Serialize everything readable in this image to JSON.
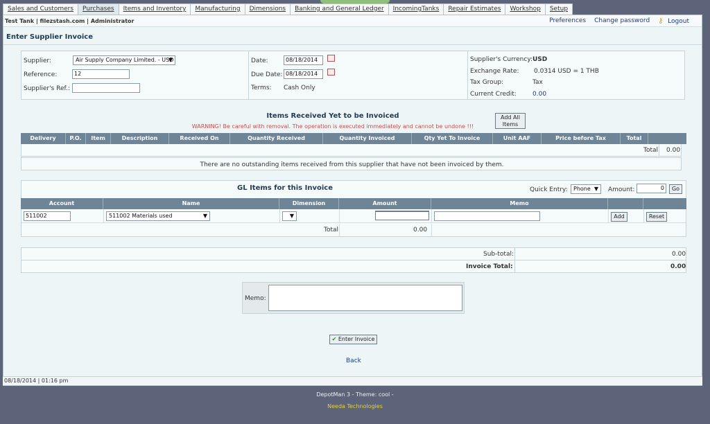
{
  "tabs": [
    {
      "label": "Sales and Customers",
      "active": false
    },
    {
      "label": "Purchases",
      "active": true
    },
    {
      "label": "Items and Inventory",
      "active": false
    },
    {
      "label": "Manufacturing",
      "active": false
    },
    {
      "label": "Dimensions",
      "active": false
    },
    {
      "label": "Banking and General Ledger",
      "active": false
    },
    {
      "label": "IncomingTanks",
      "active": false
    },
    {
      "label": "Repair Estimates",
      "active": false
    },
    {
      "label": "Workshop",
      "active": false
    },
    {
      "label": "Setup",
      "active": false
    }
  ],
  "header": {
    "company": "Test Tank | filezstash.com | Administrator",
    "preferences": "Preferences",
    "change_password": "Change password",
    "logout": "Logout"
  },
  "page_title": "Enter Supplier Invoice",
  "form": {
    "supplier_label": "Supplier:",
    "supplier_value": "Air Supply Company Limited. - USD",
    "reference_label": "Reference:",
    "reference_value": "12",
    "suppliers_ref_label": "Supplier's Ref.:",
    "suppliers_ref_value": "",
    "date_label": "Date:",
    "date_value": "08/18/2014",
    "due_date_label": "Due Date:",
    "due_date_value": "08/18/2014",
    "terms_label": "Terms:",
    "terms_value": "Cash Only",
    "currency_label": "Supplier's Currency:",
    "currency_value": "USD",
    "exchange_label": "Exchange Rate:",
    "exchange_value": "0.0314  USD = 1 THB",
    "taxgroup_label": "Tax Group:",
    "taxgroup_value": "Tax",
    "credit_label": "Current Credit:",
    "credit_value": "0.00"
  },
  "received": {
    "title": "Items Received Yet to be Invoiced",
    "warning": "WARNING! Be careful with removal. The operation is executed immediately and cannot be undone !!!",
    "add_all_label_1": "Add All",
    "add_all_label_2": "Items",
    "columns": [
      "Delivery",
      "P.O.",
      "Item",
      "Description",
      "Received On",
      "Quantity Received",
      "Quantity Invoiced",
      "Qty Yet To Invoice",
      "Unit AAF",
      "Price before Tax",
      "Total"
    ],
    "total_label": "Total",
    "total_value": "0.00",
    "empty_message": "There are no outstanding items received from this supplier that have not been invoiced by them."
  },
  "gl": {
    "title": "GL Items for this Invoice",
    "quick_entry_label": "Quick Entry:",
    "quick_entry_value": "Phone",
    "amount_label": "Amount:",
    "amount_value": "0",
    "go_label": "Go",
    "columns": [
      "Account",
      "Name",
      "Dimension",
      "Amount",
      "Memo"
    ],
    "account_value": "511002",
    "name_value": "511002    Materials used",
    "add_label": "Add",
    "reset_label": "Reset",
    "total_label": "Total",
    "total_value": "0.00"
  },
  "totals": {
    "subtotal_label": "Sub-total:",
    "subtotal_value": "0.00",
    "invoice_total_label": "Invoice Total:",
    "invoice_total_value": "0.00"
  },
  "memo_label": "Memo:",
  "enter_invoice_label": "Enter Invoice",
  "back_label": "Back",
  "status_bar": "08/18/2014 | 01:16 pm",
  "footer": {
    "line1": "DepotMan 3 - Theme: cool -",
    "line2": "Needa Technologies"
  }
}
